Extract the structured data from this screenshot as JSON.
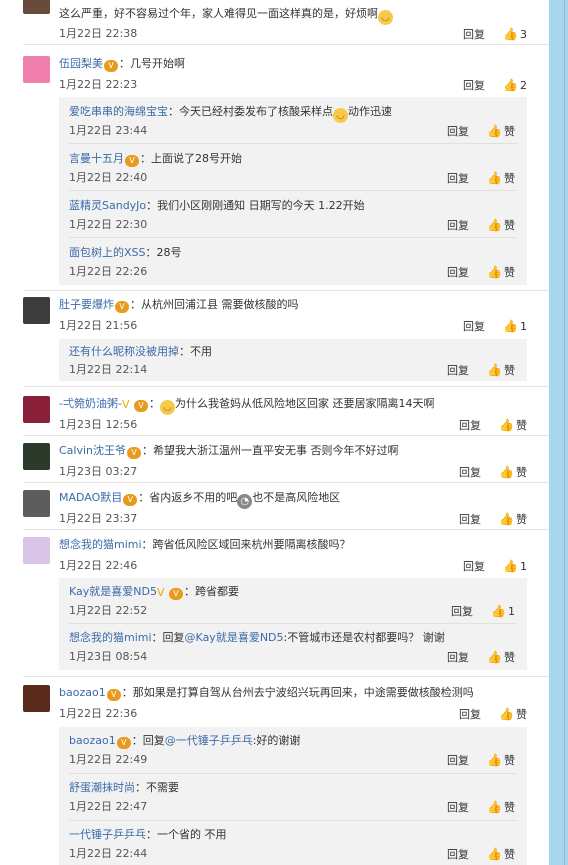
{
  "ui": {
    "reply_label": "回复",
    "like_word": "赞"
  },
  "top": {
    "partial_text": "这么严重，好不容易过个年，家人难得见一面这样真的是，好烦啊",
    "time": "1月22日 22:38",
    "likes": "3"
  },
  "entries": [
    {
      "user": "伍园梨美",
      "sep": "：",
      "text": "几号开始啊",
      "time": "1月22日 22:23",
      "likes": "2",
      "replies": [
        {
          "user": "爱吃串串的海绵宝宝",
          "sep": "：",
          "text": "今天已经村委发布了核酸采样点",
          "text2": "动作迅速",
          "time": "1月22日 23:44",
          "likes": "赞"
        },
        {
          "user": "言曼十五月",
          "sep": "：",
          "text": "上面说了28号开始",
          "time": "1月22日 22:40",
          "likes": "赞"
        },
        {
          "user": "蓝精灵SandyJo",
          "sep": "：",
          "text": "我们小区刚刚通知  日期写的今天   1.22开始",
          "time": "1月22日 22:30",
          "likes": "赞"
        },
        {
          "user": "面包树上的XSS",
          "sep": "：",
          "text": "28号",
          "time": "1月22日 22:26",
          "likes": "赞"
        }
      ]
    },
    {
      "user": "肚子要爆炸",
      "sep": "：",
      "text": "从杭州回浦江县 需要做核酸的吗",
      "time": "1月22日 21:56",
      "likes": "1",
      "replies": [
        {
          "user": "还有什么昵称没被用掉",
          "sep": "：",
          "text": "不用",
          "time": "1月22日 22:14",
          "likes": "赞"
        }
      ]
    },
    {
      "user": "-弌箢奶油粥-",
      "sep": "：",
      "text": "为什么我爸妈从低风险地区回家 还要居家隔离14天啊",
      "time": "1月23日 12:56",
      "likes": "赞",
      "replies": []
    },
    {
      "user": "Calvin沈王爷",
      "sep": "：",
      "text": "希望我大浙江温州一直平安无事 否则今年不好过啊",
      "time": "1月23日 03:27",
      "likes": "赞",
      "replies": []
    },
    {
      "user": "MADAO默目",
      "sep": "：",
      "text": "省内返乡不用的吧",
      "text2": "也不是高风险地区",
      "time": "1月22日 23:37",
      "likes": "赞",
      "replies": []
    },
    {
      "user": "想念我的猫mimi",
      "sep": "：",
      "text": "跨省低风险区域回来杭州要隔离核酸吗？",
      "time": "1月22日 22:46",
      "likes": "1",
      "replies": [
        {
          "user": "Kay就是喜爱ND5",
          "sep": "：",
          "text": "跨省都要",
          "time": "1月22日 22:52",
          "likes": "1"
        },
        {
          "user": "想念我的猫mimi",
          "sep": "：",
          "text": "回复",
          "mention": "@Kay就是喜爱ND5",
          "text2": ":不管城市还是农村都要吗？ 谢谢",
          "time": "1月23日 08:54",
          "likes": "赞"
        }
      ]
    },
    {
      "user": "baozao1",
      "sep": "：",
      "text": "那如果是打算自驾从台州去宁波绍兴玩再回来，中途需要做核酸检测吗",
      "time": "1月22日 22:36",
      "likes": "赞",
      "replies": [
        {
          "user": "baozao1",
          "sep": "：",
          "text": "回复",
          "mention": "@一代锤子乒乒乓",
          "text2": ":好的谢谢",
          "time": "1月22日 22:49",
          "likes": "赞"
        },
        {
          "user": "舒蛋潮抹时尚",
          "sep": "：",
          "text": "不需要",
          "time": "1月22日 22:47",
          "likes": "赞"
        },
        {
          "user": "一代锤子乒乒乓",
          "sep": "：",
          "text": "一个省的 不用",
          "time": "1月22日 22:44",
          "likes": "赞"
        }
      ]
    }
  ]
}
